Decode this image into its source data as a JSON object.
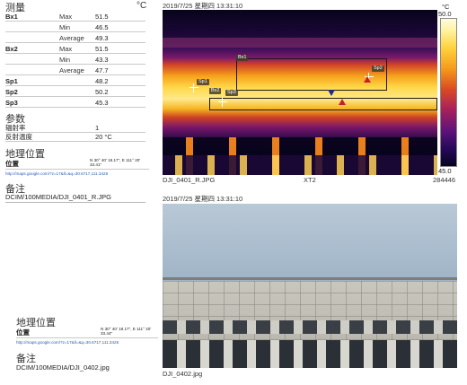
{
  "measure": {
    "title": "测量",
    "unit": "°C",
    "rows": [
      {
        "name": "Bx1",
        "stat": "Max",
        "value": "51.5"
      },
      {
        "name": "",
        "stat": "Min",
        "value": "46.5"
      },
      {
        "name": "",
        "stat": "Average",
        "value": "49.3"
      },
      {
        "name": "Bx2",
        "stat": "Max",
        "value": "51.5"
      },
      {
        "name": "",
        "stat": "Min",
        "value": "43.3"
      },
      {
        "name": "",
        "stat": "Average",
        "value": "47.7"
      },
      {
        "name": "Sp1",
        "stat": "",
        "value": "48.2"
      },
      {
        "name": "Sp2",
        "stat": "",
        "value": "50.2"
      },
      {
        "name": "Sp3",
        "stat": "",
        "value": "45.3"
      }
    ]
  },
  "params": {
    "title": "参数",
    "rows": [
      {
        "key": "辐射率",
        "value": "1"
      },
      {
        "key": "反射温度",
        "value": "20 °C"
      }
    ]
  },
  "geo1": {
    "title": "地理位置",
    "key": "位置",
    "value": "N 30° 40' 18.17\", E 111° 20' 33.41\"",
    "link": "http://maps.google.com/?z=17&ll=&q=30.6717,111.3426"
  },
  "note1": {
    "title": "备注",
    "path": "DCIM/100MEDIA/DJI_0401_R.JPG"
  },
  "geo2": {
    "title": "地理位置",
    "key": "位置",
    "value": "N 30° 40' 18.17\", E 111° 20' 33.44\"",
    "link": "http://maps.google.com/?z=17&ll=&q=30.6717,111.3426"
  },
  "note2": {
    "title": "备注",
    "path": "DCIM/100MEDIA/DJI_0402.jpg"
  },
  "thermal": {
    "timestamp": "2019/7/25 星期四 13:31:10",
    "filename": "DJI_0401_R.JPG",
    "camera": "XT2",
    "serial": "284446",
    "scale_unit": "°C",
    "scale_max": "50.0",
    "scale_min": "45.0",
    "labels": {
      "bx1": "Bx1",
      "bx2": "Bx2",
      "sp1": "Sp1",
      "sp2": "Sp2",
      "sp3": "Sp3"
    }
  },
  "photo": {
    "timestamp": "2019/7/25 星期四 13:31:10",
    "filename": "DJI_0402.jpg"
  },
  "colors": {
    "accent_link": "#2a5db0"
  }
}
